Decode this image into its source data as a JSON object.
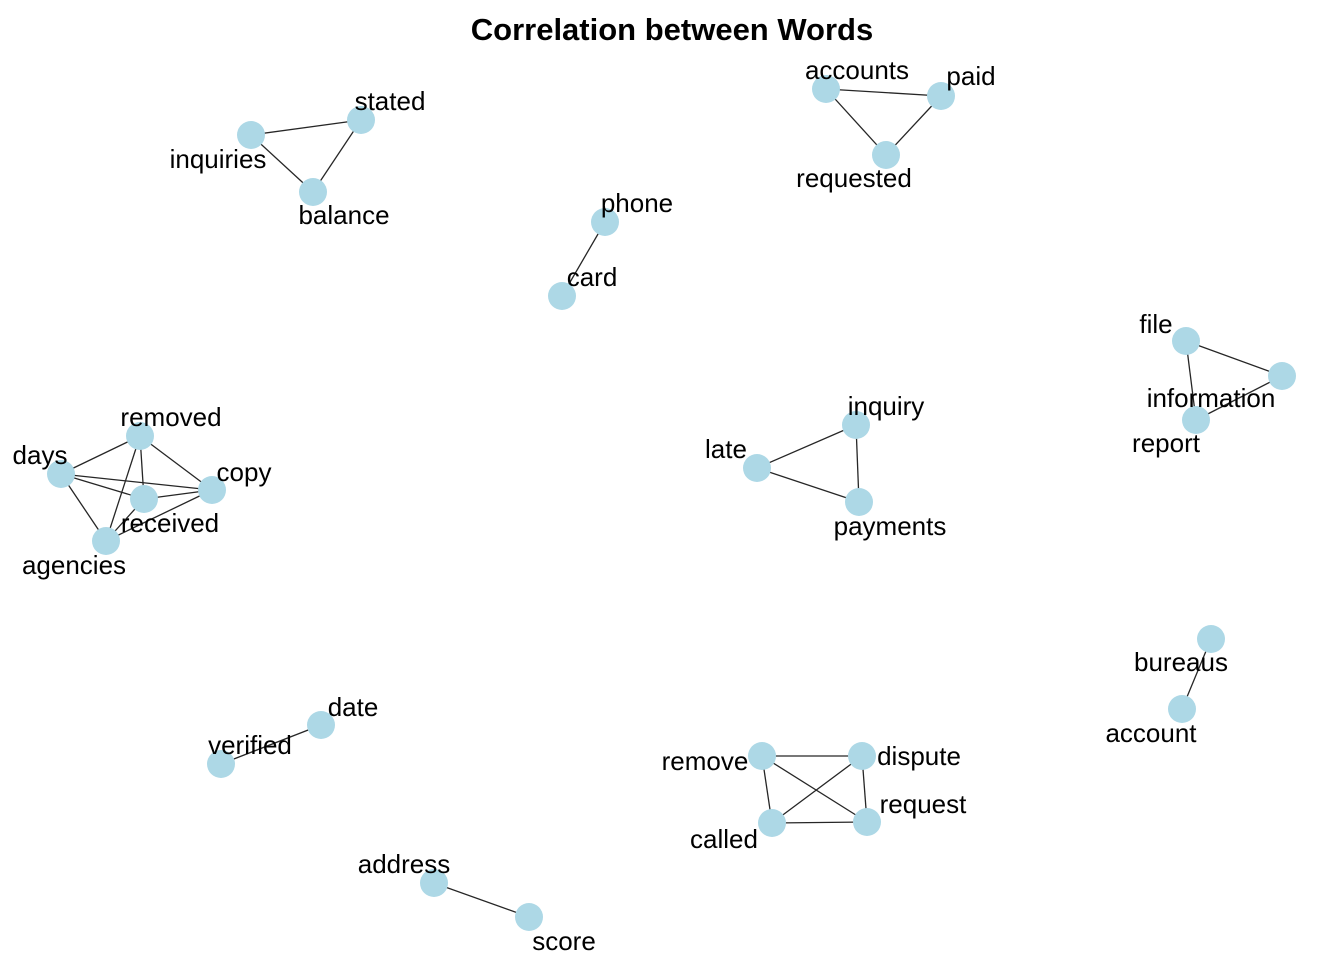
{
  "title": "Correlation between Words",
  "colors": {
    "node_fill": "#add8e6",
    "edge": "#262626",
    "text": "#000000",
    "background": "#ffffff"
  },
  "nodes": [
    {
      "id": "inquiries",
      "label": "inquiries"
    },
    {
      "id": "stated",
      "label": "stated"
    },
    {
      "id": "balance",
      "label": "balance"
    },
    {
      "id": "accounts",
      "label": "accounts"
    },
    {
      "id": "paid",
      "label": "paid"
    },
    {
      "id": "requested",
      "label": "requested"
    },
    {
      "id": "phone",
      "label": "phone"
    },
    {
      "id": "card",
      "label": "card"
    },
    {
      "id": "file",
      "label": "file"
    },
    {
      "id": "information",
      "label": "information"
    },
    {
      "id": "report",
      "label": "report"
    },
    {
      "id": "removed",
      "label": "removed"
    },
    {
      "id": "days",
      "label": "days"
    },
    {
      "id": "copy",
      "label": "copy"
    },
    {
      "id": "received",
      "label": "received"
    },
    {
      "id": "agencies",
      "label": "agencies"
    },
    {
      "id": "inquiry",
      "label": "inquiry"
    },
    {
      "id": "late",
      "label": "late"
    },
    {
      "id": "payments",
      "label": "payments"
    },
    {
      "id": "bureaus",
      "label": "bureaus"
    },
    {
      "id": "account",
      "label": "account"
    },
    {
      "id": "date",
      "label": "date"
    },
    {
      "id": "verified",
      "label": "verified"
    },
    {
      "id": "remove",
      "label": "remove"
    },
    {
      "id": "dispute",
      "label": "dispute"
    },
    {
      "id": "request",
      "label": "request"
    },
    {
      "id": "called",
      "label": "called"
    },
    {
      "id": "address",
      "label": "address"
    },
    {
      "id": "score",
      "label": "score"
    }
  ],
  "edges": [
    [
      "inquiries",
      "stated"
    ],
    [
      "inquiries",
      "balance"
    ],
    [
      "stated",
      "balance"
    ],
    [
      "accounts",
      "paid"
    ],
    [
      "accounts",
      "requested"
    ],
    [
      "paid",
      "requested"
    ],
    [
      "phone",
      "card"
    ],
    [
      "file",
      "information"
    ],
    [
      "file",
      "report"
    ],
    [
      "information",
      "report"
    ],
    [
      "days",
      "removed"
    ],
    [
      "days",
      "copy"
    ],
    [
      "days",
      "received"
    ],
    [
      "days",
      "agencies"
    ],
    [
      "removed",
      "copy"
    ],
    [
      "removed",
      "received"
    ],
    [
      "removed",
      "agencies"
    ],
    [
      "copy",
      "received"
    ],
    [
      "copy",
      "agencies"
    ],
    [
      "received",
      "agencies"
    ],
    [
      "late",
      "inquiry"
    ],
    [
      "late",
      "payments"
    ],
    [
      "inquiry",
      "payments"
    ],
    [
      "bureaus",
      "account"
    ],
    [
      "date",
      "verified"
    ],
    [
      "remove",
      "dispute"
    ],
    [
      "remove",
      "request"
    ],
    [
      "remove",
      "called"
    ],
    [
      "dispute",
      "request"
    ],
    [
      "dispute",
      "called"
    ],
    [
      "called",
      "request"
    ],
    [
      "address",
      "score"
    ]
  ]
}
